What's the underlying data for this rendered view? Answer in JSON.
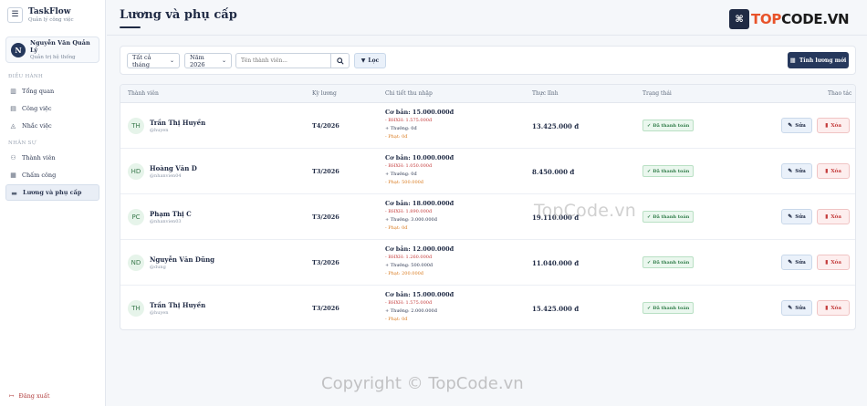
{
  "brand": {
    "name": "TaskFlow",
    "subtitle": "Quản lý công việc"
  },
  "user": {
    "initial": "N",
    "name": "Nguyễn Văn Quản Lý",
    "role": "Quản trị hệ thống"
  },
  "sidebar": {
    "sections": [
      {
        "label": "ĐIỀU HÀNH",
        "items": [
          {
            "label": "Tổng quan",
            "icon": "chart-icon"
          },
          {
            "label": "Công việc",
            "icon": "clipboard-icon"
          },
          {
            "label": "Nhắc việc",
            "icon": "bell-icon"
          }
        ]
      },
      {
        "label": "NHÂN SỰ",
        "items": [
          {
            "label": "Thành viên",
            "icon": "users-icon"
          },
          {
            "label": "Chấm công",
            "icon": "calendar-icon"
          },
          {
            "label": "Lương và phụ cấp",
            "icon": "wallet-icon",
            "active": true
          }
        ]
      }
    ],
    "logout": "Đăng xuất"
  },
  "page": {
    "title": "Lương và phụ cấp"
  },
  "logo": {
    "prefix": "TOP",
    "suffix": "CODE.VN"
  },
  "filters": {
    "month_select": "Tất cả tháng",
    "year_select": "Năm 2026",
    "search_placeholder": "Tên thành viên...",
    "filter_label": "Lọc",
    "calc_label": "Tính lương mới"
  },
  "table": {
    "columns": [
      "Thành viên",
      "Kỳ lương",
      "Chi tiết thu nhập",
      "Thực lĩnh",
      "Trạng thái",
      "Thao tác"
    ],
    "edit_label": "Sửa",
    "delete_label": "Xóa",
    "rows": [
      {
        "initials": "TH",
        "name": "Trần Thị Huyền",
        "handle": "@huyen",
        "period": "T4/2026",
        "base": "Cơ bản: 15.000.000đ",
        "insurance": "- BHXH: 1.575.000đ",
        "bonus": "+ Thưởng: 0đ",
        "fine": "- Phạt: 0đ",
        "net": "13.425.000 đ",
        "status": "Đã thanh toán"
      },
      {
        "initials": "HD",
        "name": "Hoàng Văn D",
        "handle": "@nhanvien04",
        "period": "T3/2026",
        "base": "Cơ bản: 10.000.000đ",
        "insurance": "- BHXH: 1.050.000đ",
        "bonus": "+ Thưởng: 0đ",
        "fine": "- Phạt: 500.000đ",
        "net": "8.450.000 đ",
        "status": "Đã thanh toán"
      },
      {
        "initials": "PC",
        "name": "Phạm Thị C",
        "handle": "@nhanvien03",
        "period": "T3/2026",
        "base": "Cơ bản: 18.000.000đ",
        "insurance": "- BHXH: 1.890.000đ",
        "bonus": "+ Thưởng: 3.000.000đ",
        "fine": "- Phạt: 0đ",
        "net": "19.110.000 đ",
        "status": "Đã thanh toán"
      },
      {
        "initials": "ND",
        "name": "Nguyễn Văn Dũng",
        "handle": "@dung",
        "period": "T3/2026",
        "base": "Cơ bản: 12.000.000đ",
        "insurance": "- BHXH: 1.260.000đ",
        "bonus": "+ Thưởng: 500.000đ",
        "fine": "- Phạt: 200.000đ",
        "net": "11.040.000 đ",
        "status": "Đã thanh toán"
      },
      {
        "initials": "TH",
        "name": "Trần Thị Huyền",
        "handle": "@huyen",
        "period": "T3/2026",
        "base": "Cơ bản: 15.000.000đ",
        "insurance": "- BHXH: 1.575.000đ",
        "bonus": "+ Thưởng: 2.000.000đ",
        "fine": "- Phạt: 0đ",
        "net": "15.425.000 đ",
        "status": "Đã thanh toán"
      }
    ]
  },
  "watermarks": {
    "center": "TopCode.vn",
    "bottom": "Copyright © TopCode.vn"
  }
}
